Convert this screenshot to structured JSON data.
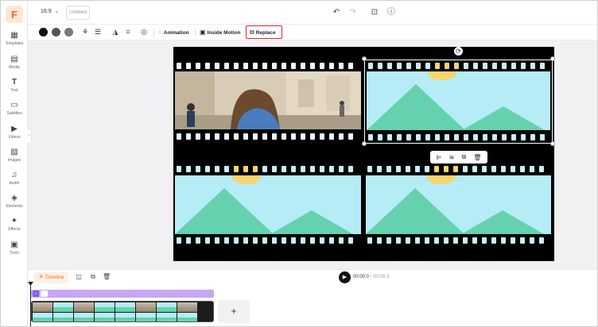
{
  "app": {
    "logo_letter": "F"
  },
  "sidebar": {
    "items": [
      {
        "label": "Templates",
        "icon": "templates-icon"
      },
      {
        "label": "Media",
        "icon": "media-icon"
      },
      {
        "label": "Text",
        "icon": "text-icon"
      },
      {
        "label": "Subtitles",
        "icon": "subtitles-icon"
      },
      {
        "label": "Videos",
        "icon": "videos-icon"
      },
      {
        "label": "Images",
        "icon": "images-icon"
      },
      {
        "label": "Audio",
        "icon": "audio-icon"
      },
      {
        "label": "Elements",
        "icon": "elements-icon"
      },
      {
        "label": "Effects",
        "icon": "effects-icon"
      },
      {
        "label": "Tools",
        "icon": "tools-icon"
      }
    ]
  },
  "header": {
    "ratio": "16:9",
    "title_placeholder": "Untitled"
  },
  "toolbar": {
    "colors": [
      "#111111",
      "#555555",
      "#777777"
    ],
    "animation_label": "Animation",
    "inside_motion_label": "Inside Motion",
    "replace_label": "Replace",
    "highlight_color": "#e0262b"
  },
  "timeline": {
    "label": "Timeline",
    "current_time": "00:00.0",
    "total_time": "/ 00:08.3",
    "add_label": "+"
  },
  "colors": {
    "accent": "#f26b1d",
    "audio_track": "#c7a6f3",
    "sky": "#b6ecf6",
    "mountain": "#66d1ae",
    "sun": "#f6d56a"
  }
}
